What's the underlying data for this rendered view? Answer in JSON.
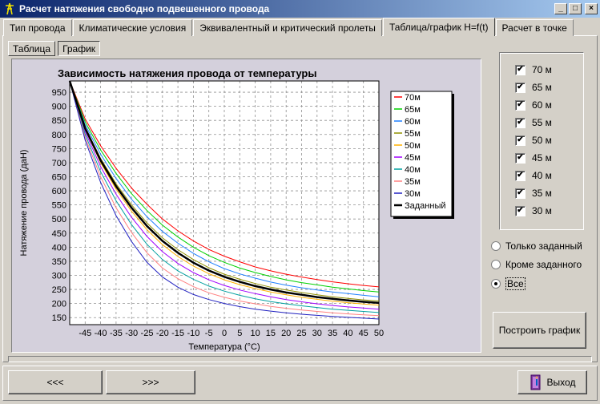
{
  "window": {
    "title": "Расчет натяжения свободно подвешенного провода",
    "minimize": "_",
    "maximize": "□",
    "close": "×"
  },
  "tabs": [
    {
      "label": "Тип провода"
    },
    {
      "label": "Климатические условия"
    },
    {
      "label": "Эквивалентный и критический пролеты"
    },
    {
      "label": "Таблица/график H=f(t)",
      "active": true
    },
    {
      "label": "Расчет в точке"
    }
  ],
  "subtabs": [
    {
      "label": "Таблица"
    },
    {
      "label": "График",
      "active": true
    }
  ],
  "checkboxes": [
    {
      "label": "70 м",
      "checked": true
    },
    {
      "label": "65 м",
      "checked": true
    },
    {
      "label": "60 м",
      "checked": true
    },
    {
      "label": "55 м",
      "checked": true
    },
    {
      "label": "50 м",
      "checked": true
    },
    {
      "label": "45 м",
      "checked": true
    },
    {
      "label": "40 м",
      "checked": true
    },
    {
      "label": "35 м",
      "checked": true
    },
    {
      "label": "30 м",
      "checked": true
    }
  ],
  "radios": [
    {
      "label": "Только заданный",
      "selected": false
    },
    {
      "label": "Кроме заданного",
      "selected": false
    },
    {
      "label": "Все",
      "selected": true
    }
  ],
  "buttons": {
    "build_chart": "Построить график",
    "prev": "<<<",
    "next": ">>>",
    "exit": "Выход"
  },
  "chart_data": {
    "type": "line",
    "title": "Зависимость натяжения провода от температуры",
    "xlabel": "Температура (°C)",
    "ylabel": "Натяжение провода (даН)",
    "xlim": [
      -50,
      50
    ],
    "ylim": [
      125,
      990
    ],
    "x_ticks": [
      -45,
      -40,
      -35,
      -30,
      -25,
      -20,
      -15,
      -10,
      -5,
      0,
      5,
      10,
      15,
      20,
      25,
      30,
      35,
      40,
      45,
      50
    ],
    "y_ticks": [
      150,
      200,
      250,
      300,
      350,
      400,
      450,
      500,
      550,
      600,
      650,
      700,
      750,
      800,
      850,
      900,
      950
    ],
    "grid": true,
    "legend": "right",
    "x": [
      -50,
      -45,
      -40,
      -35,
      -30,
      -25,
      -20,
      -15,
      -10,
      -5,
      0,
      5,
      10,
      15,
      20,
      25,
      30,
      35,
      40,
      45,
      50
    ],
    "series": [
      {
        "name": "70м",
        "color": "#ff0000",
        "values": [
          990,
          855,
          760,
          680,
          610,
          552,
          500,
          458,
          422,
          392,
          368,
          348,
          330,
          316,
          304,
          294,
          285,
          277,
          270,
          264,
          259
        ]
      },
      {
        "name": "65м",
        "color": "#00d000",
        "values": [
          990,
          845,
          745,
          662,
          590,
          530,
          478,
          436,
          400,
          370,
          346,
          326,
          310,
          296,
          284,
          274,
          266,
          258,
          252,
          246,
          241
        ]
      },
      {
        "name": "60м",
        "color": "#2080ff",
        "values": [
          990,
          835,
          730,
          644,
          570,
          508,
          456,
          414,
          378,
          348,
          324,
          305,
          290,
          276,
          265,
          256,
          248,
          241,
          235,
          229,
          224
        ]
      },
      {
        "name": "55м",
        "color": "#909000",
        "values": [
          990,
          826,
          715,
          625,
          550,
          486,
          433,
          391,
          356,
          327,
          304,
          286,
          271,
          258,
          248,
          239,
          231,
          224,
          218,
          213,
          209
        ]
      },
      {
        "name": "50м",
        "color": "#ffb000",
        "values": [
          990,
          818,
          700,
          606,
          528,
          462,
          409,
          367,
          333,
          306,
          284,
          267,
          253,
          241,
          231,
          222,
          215,
          208,
          203,
          198,
          194
        ]
      },
      {
        "name": "45м",
        "color": "#a000ff",
        "values": [
          990,
          810,
          686,
          588,
          506,
          438,
          384,
          342,
          310,
          284,
          264,
          248,
          235,
          224,
          214,
          206,
          199,
          193,
          188,
          184,
          180
        ]
      },
      {
        "name": "40м",
        "color": "#00a0a0",
        "values": [
          990,
          800,
          668,
          565,
          480,
          410,
          356,
          316,
          286,
          262,
          244,
          229,
          217,
          207,
          199,
          192,
          186,
          180,
          176,
          172,
          168
        ]
      },
      {
        "name": "35м",
        "color": "#ff8080",
        "values": [
          990,
          790,
          650,
          540,
          452,
          380,
          326,
          288,
          260,
          238,
          222,
          209,
          199,
          190,
          183,
          177,
          172,
          167,
          163,
          160,
          157
        ]
      },
      {
        "name": "30м",
        "color": "#2020c0",
        "values": [
          990,
          780,
          630,
          512,
          420,
          346,
          294,
          258,
          232,
          214,
          200,
          189,
          180,
          173,
          167,
          162,
          158,
          154,
          151,
          148,
          145
        ]
      },
      {
        "name": "Заданный",
        "color": "#000000",
        "values": [
          990,
          822,
          708,
          616,
          540,
          475,
          422,
          380,
          345,
          317,
          295,
          277,
          262,
          250,
          239,
          231,
          223,
          217,
          211,
          206,
          202
        ]
      }
    ]
  }
}
